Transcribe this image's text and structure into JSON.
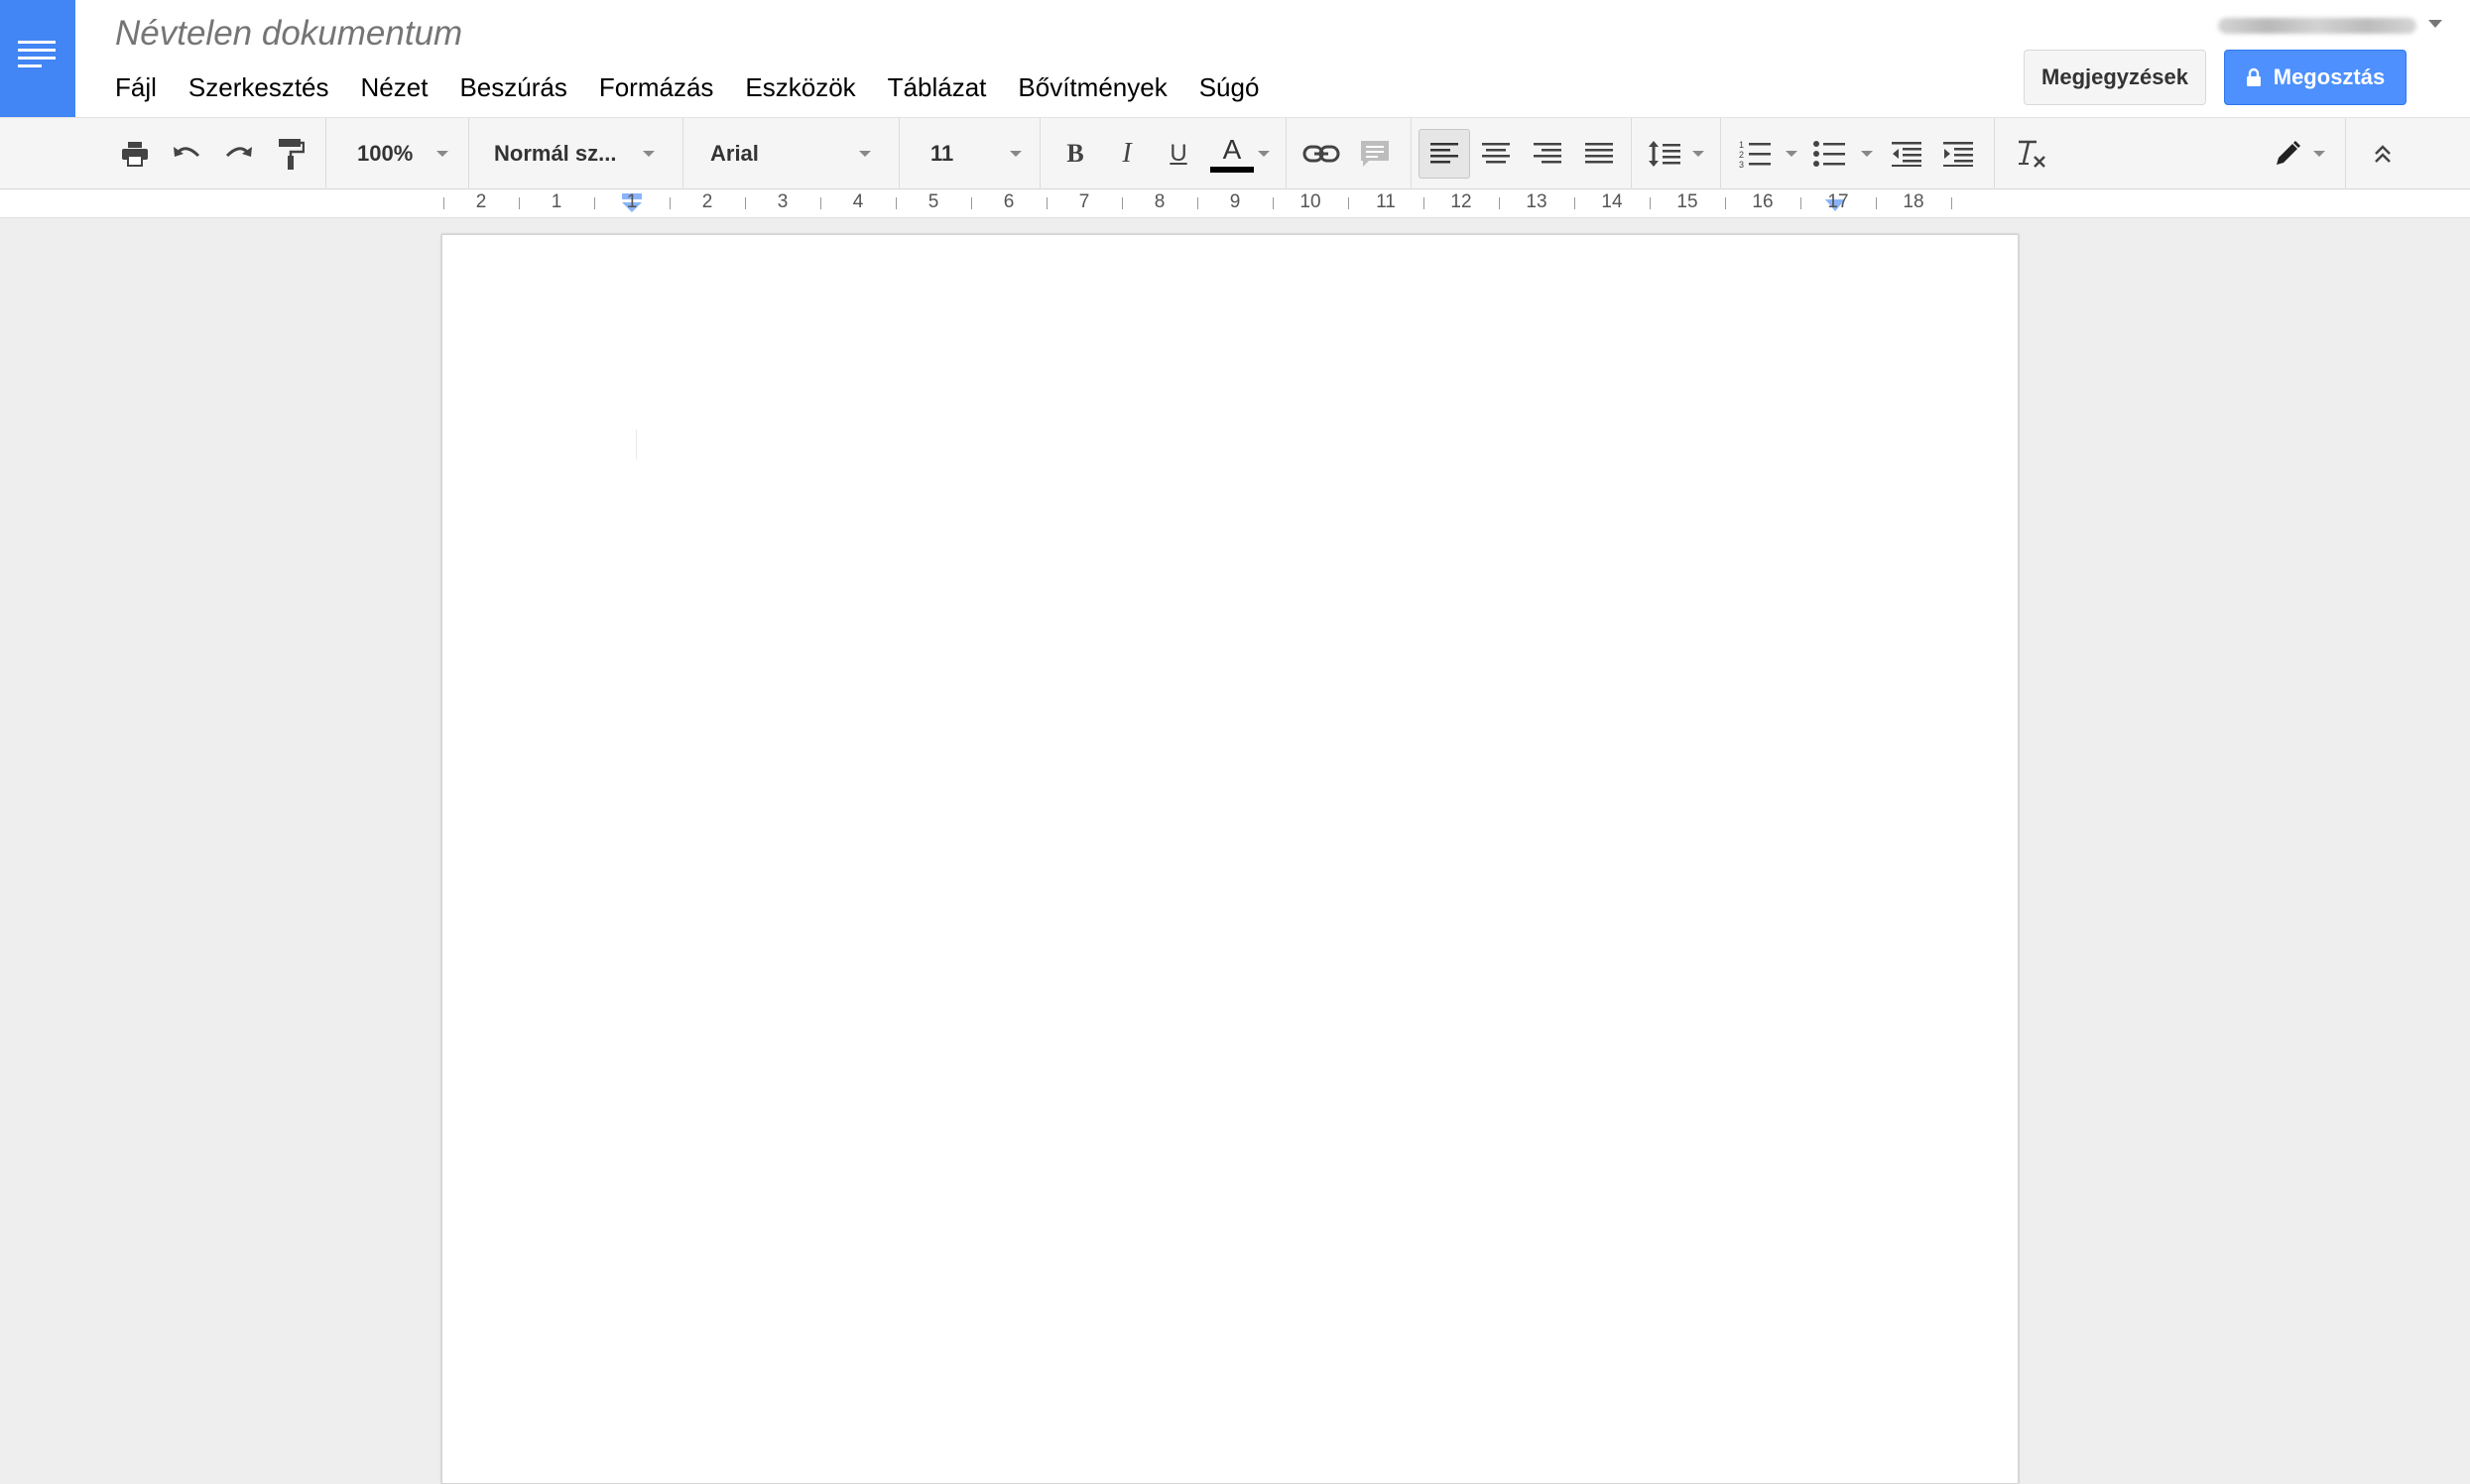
{
  "document": {
    "title": "Névtelen dokumentum"
  },
  "menu": [
    "Fájl",
    "Szerkesztés",
    "Nézet",
    "Beszúrás",
    "Formázás",
    "Eszközök",
    "Táblázat",
    "Bővítmények",
    "Súgó"
  ],
  "header": {
    "comments_label": "Megjegyzések",
    "share_label": "Megosztás"
  },
  "toolbar": {
    "zoom": "100%",
    "style": "Normál sz...",
    "font": "Arial",
    "font_size": "11",
    "text_color": "#000000",
    "alignment": "left",
    "icons": [
      "print-icon",
      "undo-icon",
      "redo-icon",
      "paint-format-icon",
      "bold-icon",
      "italic-icon",
      "underline-icon",
      "text-color-icon",
      "link-icon",
      "comment-icon",
      "align-left-icon",
      "align-center-icon",
      "align-right-icon",
      "align-justify-icon",
      "line-spacing-icon",
      "numbered-list-icon",
      "bulleted-list-icon",
      "decrease-indent-icon",
      "increase-indent-icon",
      "clear-formatting-icon",
      "edit-mode-icon",
      "collapse-icon"
    ]
  },
  "ruler": {
    "labels": [
      "2",
      "1",
      "1",
      "2",
      "3",
      "4",
      "5",
      "6",
      "7",
      "8",
      "9",
      "10",
      "11",
      "12",
      "13",
      "14",
      "15",
      "16",
      "17",
      "18"
    ]
  },
  "colors": {
    "brand": "#4285f4",
    "share_button": "#4d90fe",
    "background": "#eeeeee"
  }
}
